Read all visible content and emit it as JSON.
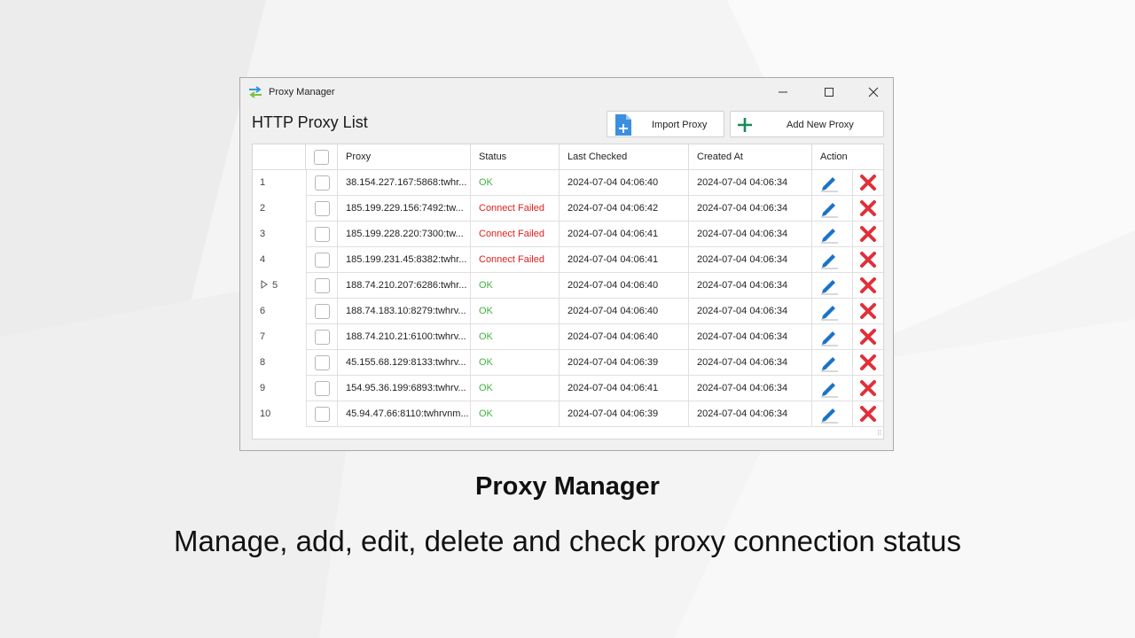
{
  "window": {
    "title": "Proxy Manager"
  },
  "header": {
    "list_title": "HTTP Proxy List",
    "import_label": "Import Proxy",
    "add_label": "Add New Proxy"
  },
  "table": {
    "columns": [
      "",
      "",
      "Proxy",
      "Status",
      "Last Checked",
      "Created At",
      "Action"
    ],
    "rows": [
      {
        "num": "1",
        "proxy": "38.154.227.167:5868:twhr...",
        "status": "OK",
        "status_kind": "ok",
        "last_checked": "2024-07-04 04:06:40",
        "created_at": "2024-07-04 04:06:34"
      },
      {
        "num": "2",
        "proxy": "185.199.229.156:7492:tw...",
        "status": "Connect Failed",
        "status_kind": "fail",
        "last_checked": "2024-07-04 04:06:42",
        "created_at": "2024-07-04 04:06:34"
      },
      {
        "num": "3",
        "proxy": "185.199.228.220:7300:tw...",
        "status": "Connect Failed",
        "status_kind": "fail",
        "last_checked": "2024-07-04 04:06:41",
        "created_at": "2024-07-04 04:06:34"
      },
      {
        "num": "4",
        "proxy": "185.199.231.45:8382:twhr...",
        "status": "Connect Failed",
        "status_kind": "fail",
        "last_checked": "2024-07-04 04:06:41",
        "created_at": "2024-07-04 04:06:34"
      },
      {
        "num": "5",
        "proxy": "188.74.210.207:6286:twhr...",
        "status": "OK",
        "status_kind": "ok",
        "last_checked": "2024-07-04 04:06:40",
        "created_at": "2024-07-04 04:06:34",
        "current": true
      },
      {
        "num": "6",
        "proxy": "188.74.183.10:8279:twhrv...",
        "status": "OK",
        "status_kind": "ok",
        "last_checked": "2024-07-04 04:06:40",
        "created_at": "2024-07-04 04:06:34"
      },
      {
        "num": "7",
        "proxy": "188.74.210.21:6100:twhrv...",
        "status": "OK",
        "status_kind": "ok",
        "last_checked": "2024-07-04 04:06:40",
        "created_at": "2024-07-04 04:06:34"
      },
      {
        "num": "8",
        "proxy": "45.155.68.129:8133:twhrv...",
        "status": "OK",
        "status_kind": "ok",
        "last_checked": "2024-07-04 04:06:39",
        "created_at": "2024-07-04 04:06:34"
      },
      {
        "num": "9",
        "proxy": "154.95.36.199:6893:twhrv...",
        "status": "OK",
        "status_kind": "ok",
        "last_checked": "2024-07-04 04:06:41",
        "created_at": "2024-07-04 04:06:34"
      },
      {
        "num": "10",
        "proxy": "45.94.47.66:8110:twhrvnm...",
        "status": "OK",
        "status_kind": "ok",
        "last_checked": "2024-07-04 04:06:39",
        "created_at": "2024-07-04 04:06:34"
      }
    ]
  },
  "caption": {
    "title": "Proxy Manager",
    "subtitle": "Manage, add, edit, delete and check proxy connection status"
  },
  "colors": {
    "ok": "#3fb33f",
    "fail": "#e02020",
    "edit_icon": "#1a73c8",
    "delete_icon": "#e0303a",
    "add_icon": "#1a8a5a",
    "import_icon": "#3b8fe0"
  },
  "icons": {
    "app": "proxy-swap-arrows-icon",
    "import": "document-plus-icon",
    "add": "plus-icon",
    "edit": "pencil-icon",
    "delete": "x-icon",
    "current_row": "triangle-right-icon"
  }
}
